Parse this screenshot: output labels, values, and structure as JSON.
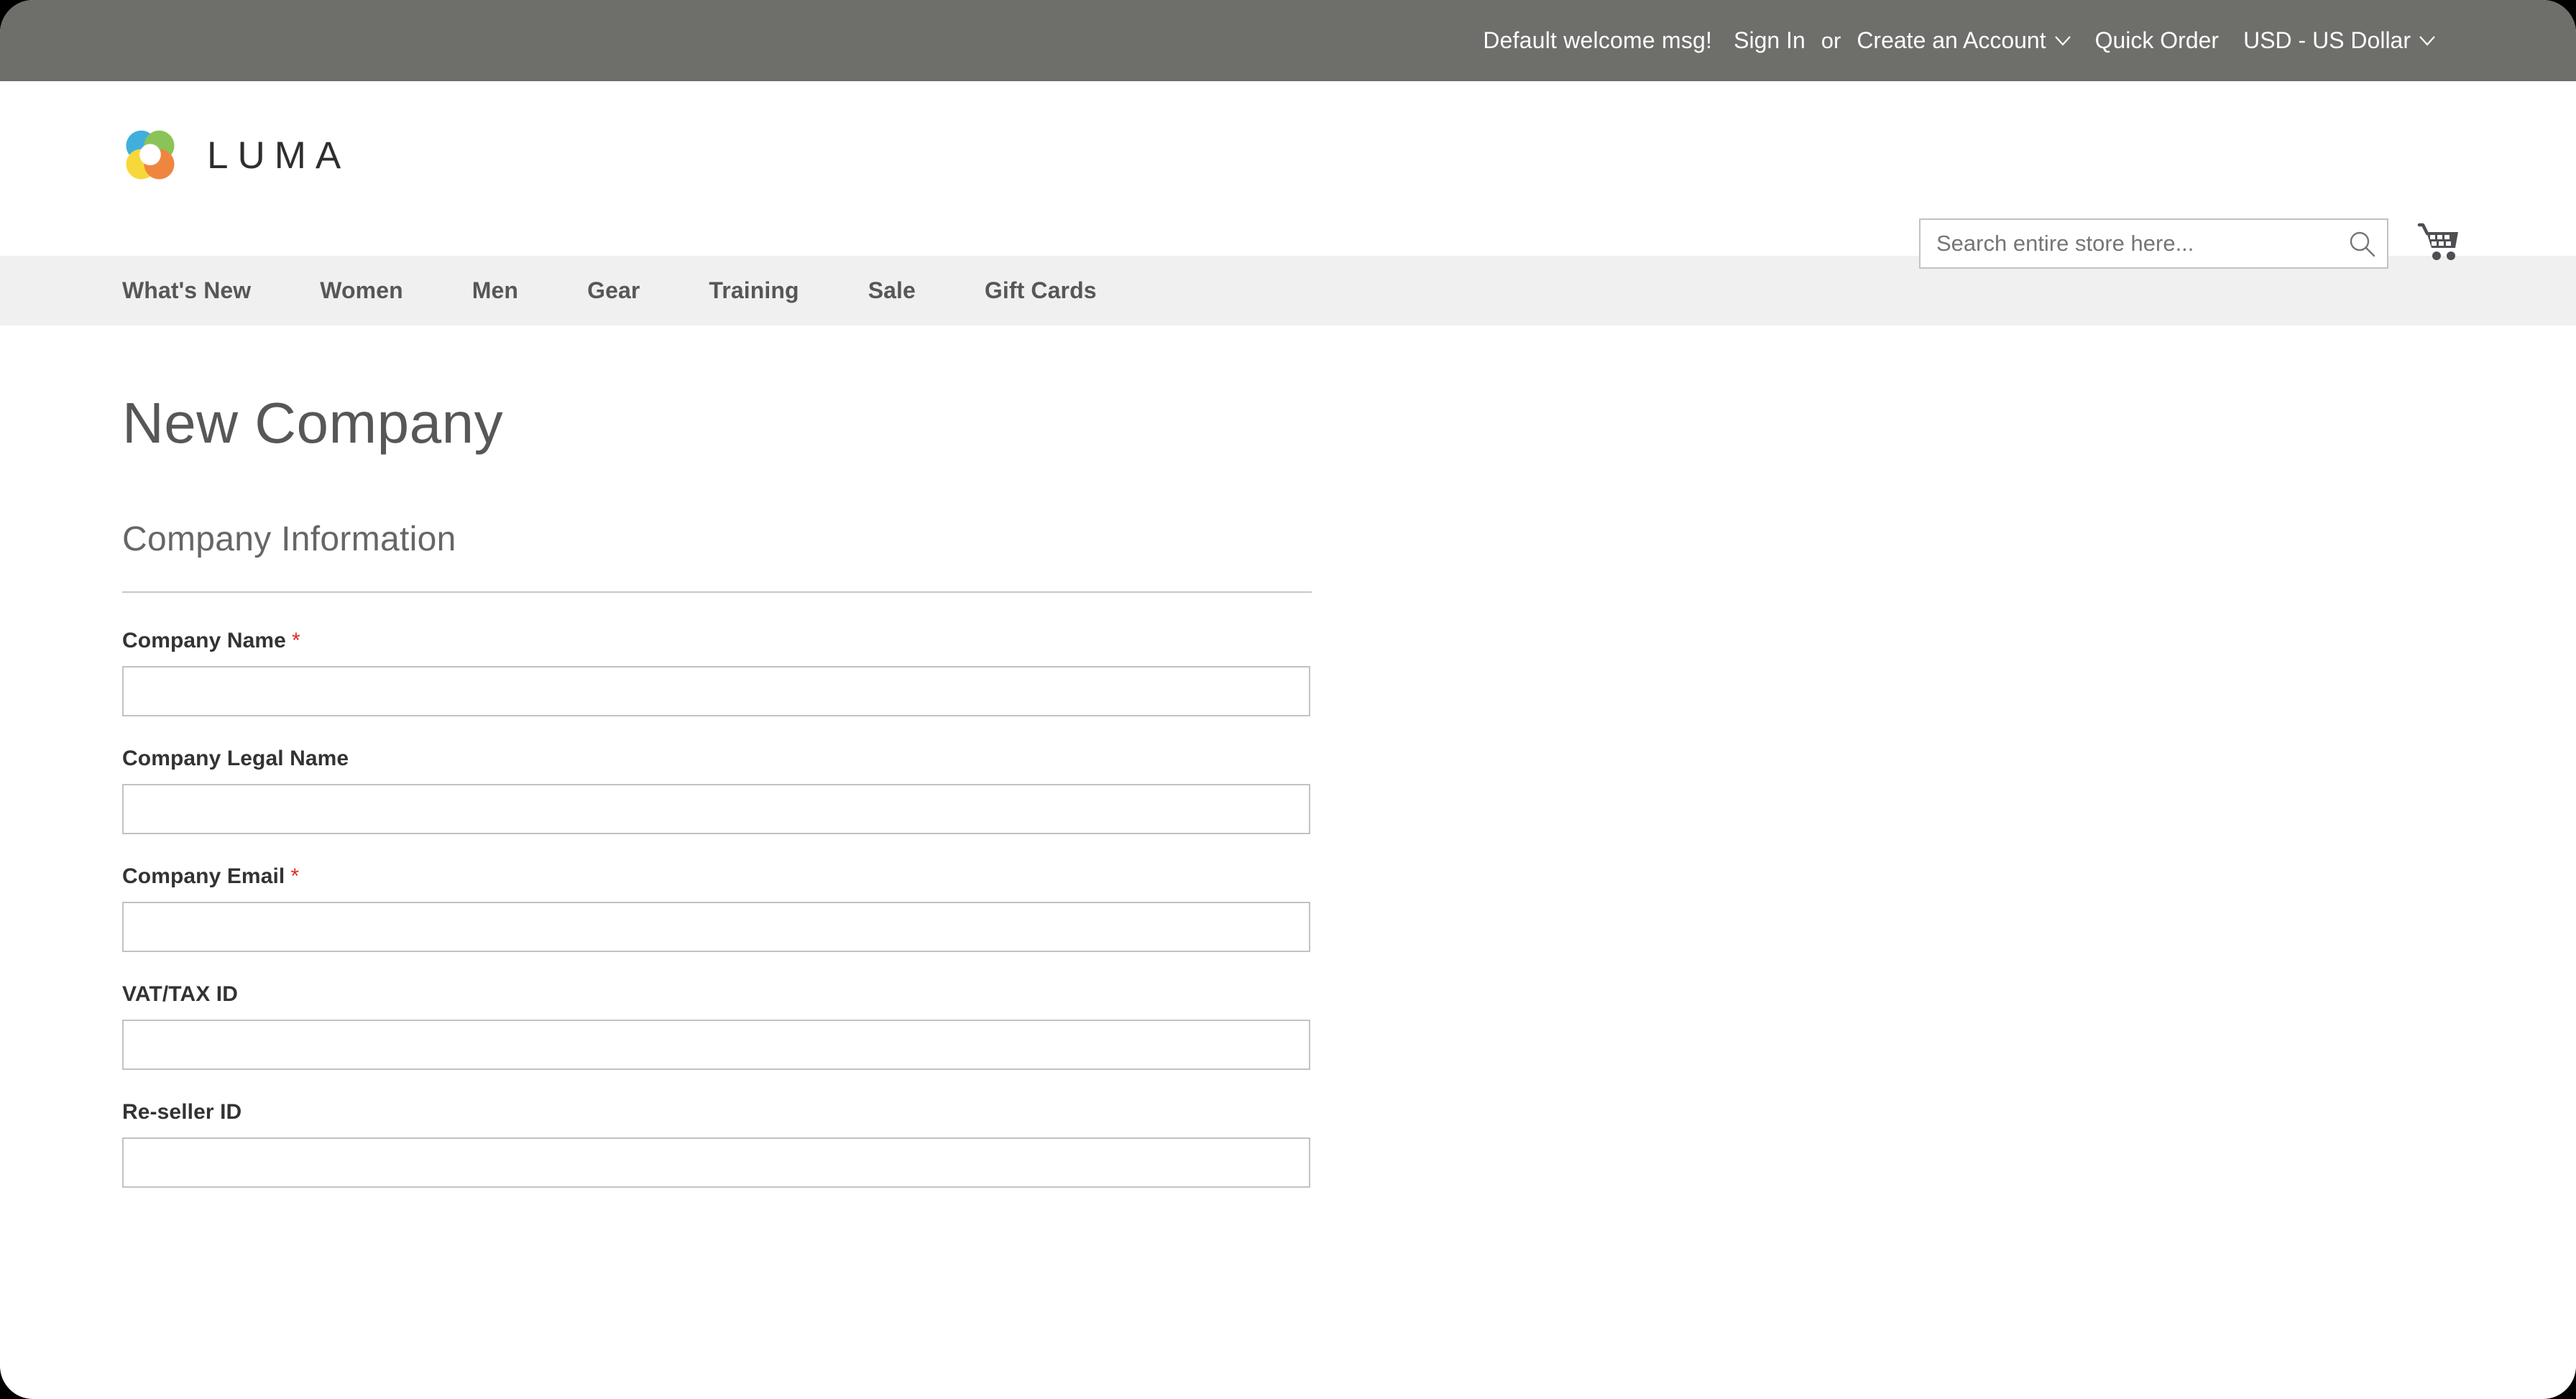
{
  "top_panel": {
    "welcome_message": "Default welcome msg!",
    "sign_in": "Sign In",
    "or": "or",
    "create_account": "Create an Account",
    "quick_order": "Quick Order",
    "currency": "USD - US Dollar"
  },
  "header": {
    "logo_text": "LUMA",
    "logo_colors": {
      "blue": "#26a4da",
      "green": "#7bbd42",
      "yellow": "#f5d320",
      "orange": "#ec7625"
    },
    "search": {
      "placeholder": "Search entire store here...",
      "value": "",
      "icon": "search-icon"
    },
    "cart": {
      "icon": "shopping-cart-icon"
    }
  },
  "nav": {
    "items": [
      {
        "label": "What's New"
      },
      {
        "label": "Women"
      },
      {
        "label": "Men"
      },
      {
        "label": "Gear"
      },
      {
        "label": "Training"
      },
      {
        "label": "Sale"
      },
      {
        "label": "Gift Cards"
      }
    ]
  },
  "main": {
    "page_title": "New Company",
    "legend": "Company Information",
    "required_marker": "*",
    "fields": [
      {
        "label": "Company Name",
        "required": true,
        "value": "",
        "placeholder": ""
      },
      {
        "label": "Company Legal Name",
        "required": false,
        "value": "",
        "placeholder": ""
      },
      {
        "label": "Company Email",
        "required": true,
        "value": "",
        "placeholder": ""
      },
      {
        "label": "VAT/TAX ID",
        "required": false,
        "value": "",
        "placeholder": ""
      },
      {
        "label": "Re-seller ID",
        "required": false,
        "value": "",
        "placeholder": ""
      }
    ]
  },
  "colors": {
    "top_panel_bg": "#6e6e6b",
    "nav_bg": "#f0f0f0",
    "required_star": "#e02b27",
    "text_dark": "#333333",
    "text_muted": "#575757",
    "border": "#c2c2c2"
  }
}
